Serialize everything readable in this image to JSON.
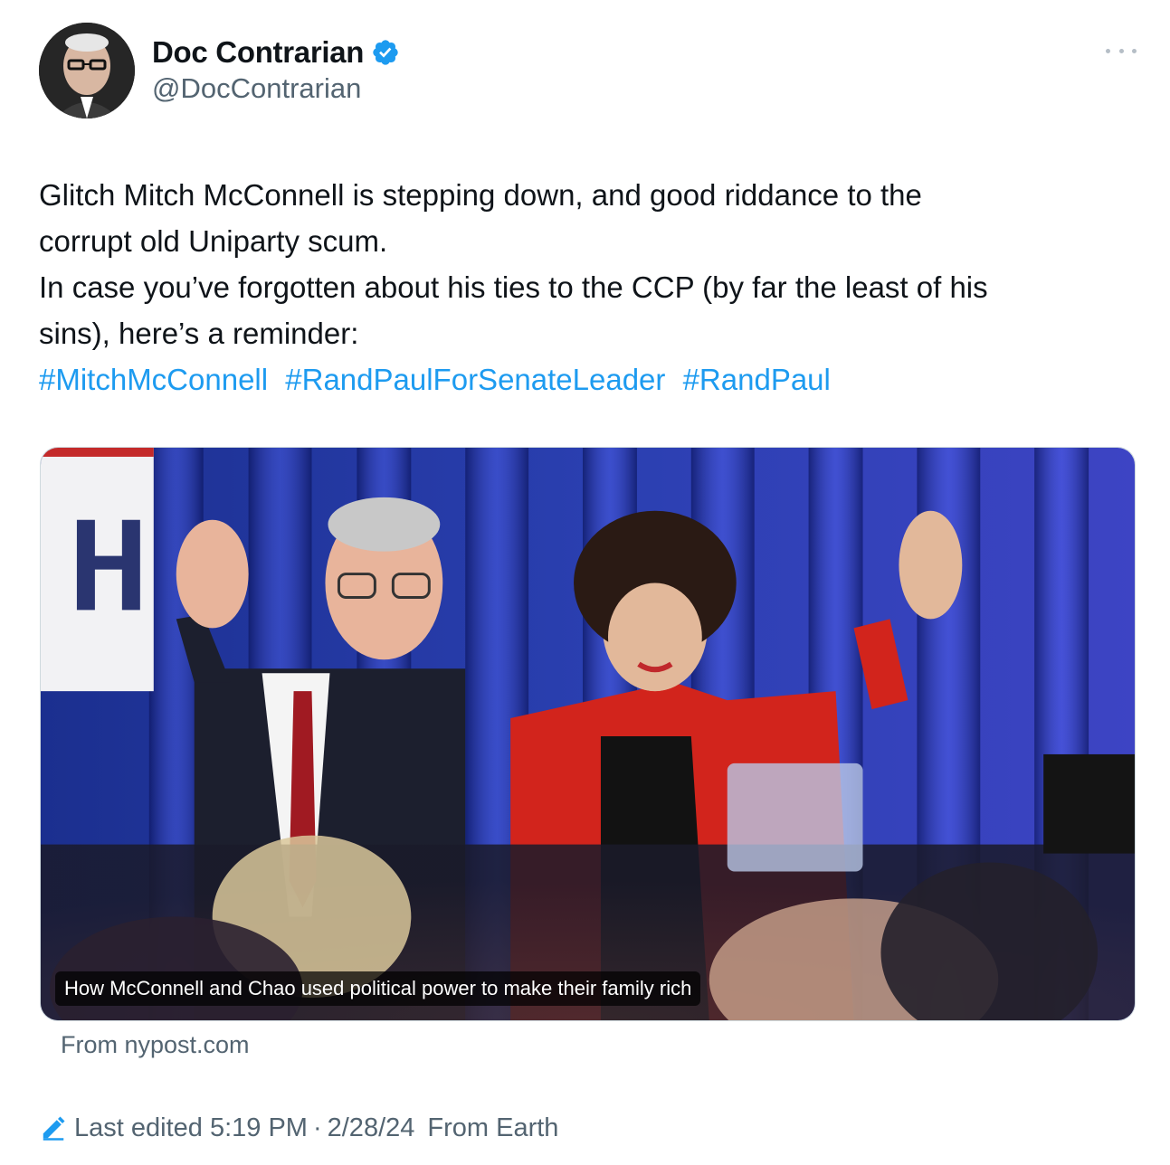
{
  "author": {
    "display_name": "Doc Contrarian",
    "handle": "@DocContrarian",
    "verified": true,
    "avatar_icon": "profile-avatar"
  },
  "tweet": {
    "lines": [
      "Glitch Mitch McConnell is stepping down, and good riddance to the",
      "corrupt old Uniparty scum.",
      "In case you’ve forgotten about his ties to the CCP (by far the least of his",
      "sins), here’s a reminder:"
    ],
    "hashtags": [
      "#MitchMcConnell",
      "#RandPaulForSenateLeader",
      "#RandPaul"
    ]
  },
  "link_card": {
    "caption": "How McConnell and Chao used political power to make their family rich",
    "source": "From nypost.com"
  },
  "footer": {
    "edit_icon": "pencil-icon",
    "last_edited": "Last edited 5:19 PM",
    "separator": "·",
    "date": "2/28/24",
    "location": "From Earth"
  },
  "colors": {
    "link": "#1d9bf0",
    "text": "#0f1419",
    "secondary": "#536471",
    "verified_badge": "#1d9bf0"
  }
}
